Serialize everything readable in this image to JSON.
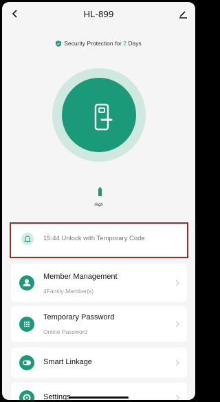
{
  "header": {
    "title": "HL-899"
  },
  "security": {
    "prefix": "Security Protection for ",
    "days": "2",
    "suffix": " Days"
  },
  "battery": {
    "label": "High"
  },
  "last_event": {
    "text": "15:44 Unlock with Temporary Code"
  },
  "menu": {
    "items": [
      {
        "title": "Member Management",
        "subtitle": "4Family Member(s)"
      },
      {
        "title": "Temporary Password",
        "subtitle": "Online Password"
      },
      {
        "title": "Smart Linkage",
        "subtitle": ""
      },
      {
        "title": "Settings",
        "subtitle": ""
      }
    ]
  },
  "colors": {
    "accent": "#1b9a79",
    "accent_light": "#cfe9e1",
    "highlight_border": "#a32a26"
  }
}
